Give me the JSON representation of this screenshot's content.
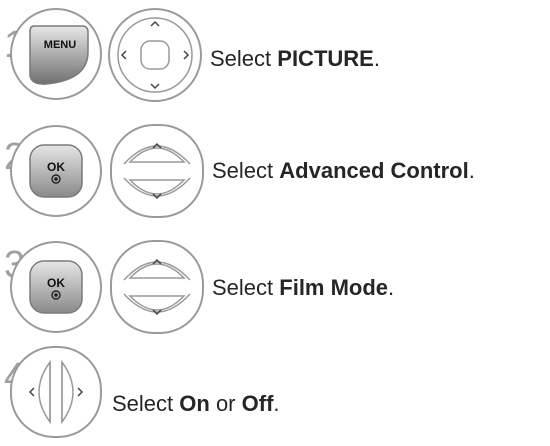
{
  "steps": [
    {
      "number": "1",
      "buttons": [
        "MENU",
        "navigation-pad"
      ],
      "text_prefix": "Select ",
      "text_bold": "PICTURE",
      "text_suffix": "."
    },
    {
      "number": "2",
      "buttons": [
        "OK",
        "up-down"
      ],
      "text_prefix": "Select ",
      "text_bold": "Advanced Control",
      "text_suffix": "."
    },
    {
      "number": "3",
      "buttons": [
        "OK",
        "up-down"
      ],
      "text_prefix": "Select ",
      "text_bold": "Film Mode",
      "text_suffix": "."
    },
    {
      "number": "4",
      "buttons": [
        "left-right"
      ],
      "text_prefix": "Select ",
      "text_bold": "On",
      "text_middle": " or ",
      "text_bold2": "Off",
      "text_suffix": "."
    }
  ],
  "labels": {
    "menu": "MENU",
    "ok": "OK"
  },
  "colors": {
    "outline": "#9a9a9a",
    "key_gradient_light": "#d6d6d6",
    "key_gradient_dark": "#8c8c8c",
    "text": "#262626",
    "step_number": "#a0a0a0"
  }
}
